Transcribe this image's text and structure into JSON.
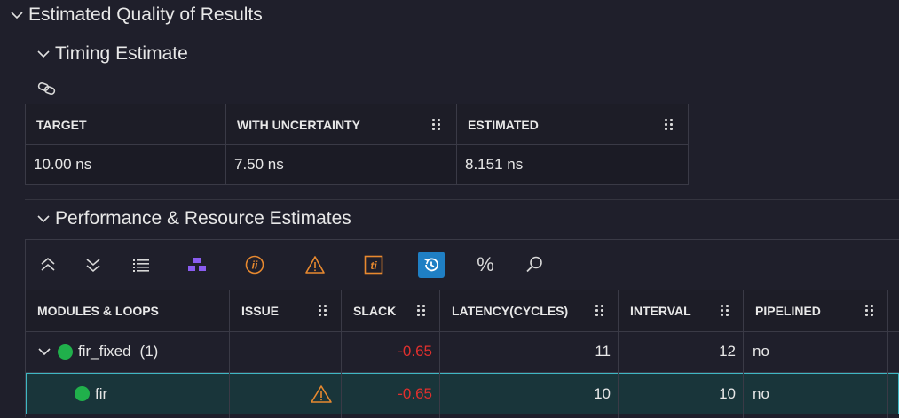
{
  "sections": {
    "quality": {
      "title": "Estimated Quality of Results"
    },
    "timing": {
      "title": "Timing Estimate"
    },
    "perf": {
      "title": "Performance & Resource Estimates"
    }
  },
  "timing_table": {
    "headers": [
      "TARGET",
      "WITH UNCERTAINTY",
      "ESTIMATED"
    ],
    "values": [
      "10.00 ns",
      "7.50 ns",
      "8.151 ns"
    ]
  },
  "toolbar": {
    "icons": [
      "collapse-all-icon",
      "expand-all-icon",
      "list-view-icon",
      "hierarchy-icon",
      "ii-icon",
      "warning-icon",
      "ti-icon",
      "history-icon",
      "percent-icon",
      "search-icon"
    ],
    "percent_label": "%"
  },
  "perf_table": {
    "headers": [
      "MODULES & LOOPS",
      "ISSUE",
      "SLACK",
      "LATENCY(CYCLES)",
      "INTERVAL",
      "PIPELINED"
    ],
    "rows": [
      {
        "name": "fir_fixed",
        "count": "(1)",
        "issue": "",
        "slack": "-0.65",
        "latency": "11",
        "interval": "12",
        "pipelined": "no"
      },
      {
        "name": "fir",
        "count": "",
        "issue": "warning",
        "slack": "-0.65",
        "latency": "10",
        "interval": "10",
        "pipelined": "no"
      }
    ]
  },
  "colors": {
    "background": "#1f1f2b",
    "negative": "#e0302e",
    "status_ok": "#20b04b",
    "accent": "#1f7fc4",
    "warning": "#e8892f",
    "hierarchy": "#8a5cf0",
    "selected_row": "#19353a"
  }
}
